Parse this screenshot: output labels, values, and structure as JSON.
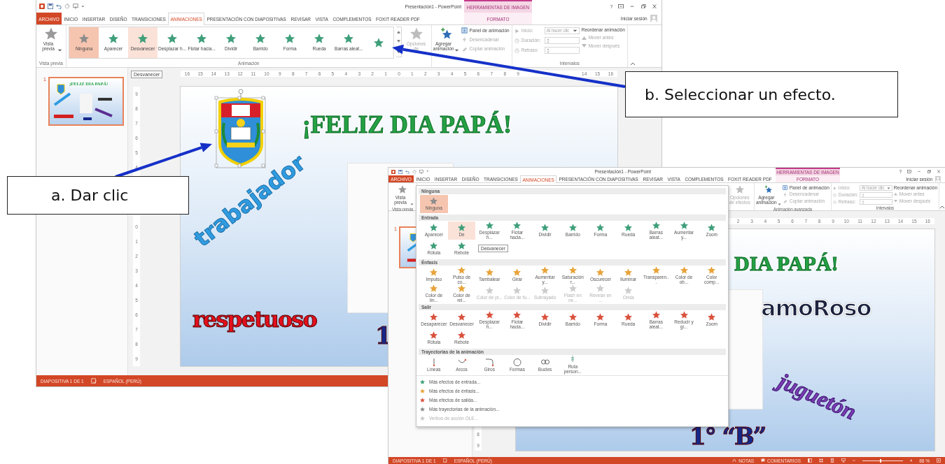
{
  "window_a": {
    "title": "Presentación1 - PowerPoint",
    "contextual_header": "HERRAMIENTAS DE IMAGEN",
    "help": "?",
    "sign_in": "Iniciar sesión",
    "tabs": [
      {
        "label": "ARCHIVO",
        "kind": "file",
        "selected": false
      },
      {
        "label": "INICIO",
        "kind": "tab",
        "selected": false
      },
      {
        "label": "INSERTAR",
        "kind": "tab",
        "selected": false
      },
      {
        "label": "DISEÑO",
        "kind": "tab",
        "selected": false
      },
      {
        "label": "TRANSICIONES",
        "kind": "tab",
        "selected": false
      },
      {
        "label": "ANIMACIONES",
        "kind": "tab",
        "selected": true
      },
      {
        "label": "PRESENTACIÓN CON DIAPOSITIVAS",
        "kind": "tab",
        "selected": false
      },
      {
        "label": "REVISAR",
        "kind": "tab",
        "selected": false
      },
      {
        "label": "VISTA",
        "kind": "tab",
        "selected": false
      },
      {
        "label": "COMPLEMENTOS",
        "kind": "tab",
        "selected": false
      },
      {
        "label": "FOXIT READER PDF",
        "kind": "tab",
        "selected": false
      },
      {
        "label": "FORMATO",
        "kind": "contextual",
        "selected": false
      }
    ],
    "ribbon": {
      "groups": [
        {
          "kind": "preview",
          "label": "Vista previa",
          "button": "Vista previa"
        },
        {
          "kind": "animation",
          "label": "Animación",
          "gallery": [
            {
              "label": "Ninguna",
              "kind": "none",
              "selected": true,
              "hovered": false
            },
            {
              "label": "Aparecer",
              "kind": "entrance",
              "selected": false,
              "hovered": false
            },
            {
              "label": "Desvanecer",
              "kind": "entrance",
              "selected": false,
              "hovered": true
            },
            {
              "label": "Desplazar h...",
              "kind": "entrance",
              "selected": false,
              "hovered": false
            },
            {
              "label": "Flotar hacia...",
              "kind": "entrance",
              "selected": false,
              "hovered": false
            },
            {
              "label": "Dividir",
              "kind": "entrance",
              "selected": false,
              "hovered": false
            },
            {
              "label": "Barrido",
              "kind": "entrance",
              "selected": false,
              "hovered": false
            },
            {
              "label": "Forma",
              "kind": "entrance",
              "selected": false,
              "hovered": false
            },
            {
              "label": "Rueda",
              "kind": "entrance",
              "selected": false,
              "hovered": false
            },
            {
              "label": "Barras aleat...",
              "kind": "entrance",
              "selected": false,
              "hovered": false
            }
          ],
          "effect_options": {
            "label": "Opciones de",
            "disabled": true
          }
        },
        {
          "kind": "advanced",
          "add": "Agregar animación",
          "items": [
            {
              "label": "Panel de animación",
              "disabled": false
            },
            {
              "label": "Desencadenar",
              "disabled": true
            },
            {
              "label": "Copiar animación",
              "disabled": true
            }
          ]
        },
        {
          "kind": "timing",
          "label": "Intervalos",
          "fields": [
            {
              "label": "Inicio:",
              "value": "Al hacer clic",
              "disabled": true
            },
            {
              "label": "Duración:",
              "disabled": true
            },
            {
              "label": "Retraso:",
              "disabled": true
            }
          ],
          "reorder_title": "Reordenar animación",
          "reorder": [
            {
              "label": "Mover antes",
              "disabled": true
            },
            {
              "label": "Mover después",
              "disabled": true
            }
          ]
        }
      ]
    },
    "tooltip": "Desvanecer",
    "slide_number": "1",
    "thumbnail": {
      "title": "¡FELIZ DIA PAPÁ!",
      "selected": true
    },
    "ruler_h_segments": [
      [
        "16",
        "15",
        "14",
        "13",
        "12",
        "11",
        "10",
        "9",
        "8",
        "7",
        "6",
        "5",
        "4",
        "3",
        "2",
        "1",
        "0",
        "1",
        "2",
        "3",
        "4",
        "5",
        "6",
        "7",
        "8",
        "9"
      ],
      [
        "14",
        "15",
        "16"
      ]
    ],
    "ruler_v_segments": [
      [
        "9",
        "8",
        "7",
        "6",
        "5",
        "4"
      ],
      [
        "0",
        "1",
        "2",
        "3",
        "4",
        "5",
        "6",
        "7",
        "8",
        "9"
      ]
    ],
    "slide": {
      "words": [
        {
          "text": "¡FELIZ DIA PAPÁ!",
          "kind": "title",
          "color": "#25a244"
        },
        {
          "text": "trabajador",
          "kind": "diagonal",
          "color": "#2f9be0"
        },
        {
          "text": "respetuoso",
          "kind": "plain",
          "color": "#e3101c"
        },
        {
          "text": "1",
          "kind": "plain",
          "color": "#15288a"
        }
      ]
    },
    "status": {
      "slide": "DIAPOSITIVA 1 DE 1",
      "language": "ESPAÑOL (PERÚ)"
    }
  },
  "window_b": {
    "title": "Presentación1 - PowerPoint",
    "contextual_header": "HERRAMIENTAS DE IMAGEN",
    "help": "?",
    "sign_in": "Iniciar sesión",
    "tabs": [
      {
        "label": "ARCHIVO",
        "kind": "file",
        "selected": false
      },
      {
        "label": "INICIO",
        "kind": "tab",
        "selected": false
      },
      {
        "label": "INSERTAR",
        "kind": "tab",
        "selected": false
      },
      {
        "label": "DISEÑO",
        "kind": "tab",
        "selected": false
      },
      {
        "label": "TRANSICIONES",
        "kind": "tab",
        "selected": false
      },
      {
        "label": "ANIMACIONES",
        "kind": "tab",
        "selected": true
      },
      {
        "label": "PRESENTACIÓN CON DIAPOSITIVAS",
        "kind": "tab",
        "selected": false
      },
      {
        "label": "REVISAR",
        "kind": "tab",
        "selected": false
      },
      {
        "label": "VISTA",
        "kind": "tab",
        "selected": false
      },
      {
        "label": "COMPLEMENTOS",
        "kind": "tab",
        "selected": false
      },
      {
        "label": "FOXIT READER PDF",
        "kind": "tab",
        "selected": false
      },
      {
        "label": "FORMATO",
        "kind": "contextual",
        "selected": false
      }
    ],
    "ribbon": {
      "groups": [
        {
          "kind": "preview",
          "label": "Vista previa",
          "button": "Vista previa"
        },
        {
          "kind": "animation",
          "effect_options": {
            "label": "Opciones de efectos",
            "disabled": true
          }
        },
        {
          "kind": "advanced",
          "label": "Animación avanzada",
          "add": "Agregar animación",
          "items": [
            {
              "label": "Panel de animación",
              "disabled": false
            },
            {
              "label": "Desencadenar",
              "disabled": true
            },
            {
              "label": "Copiar animación",
              "disabled": true
            }
          ]
        },
        {
          "kind": "timing",
          "label": "Intervalos",
          "fields": [
            {
              "label": "Inicio:",
              "value": "Al hacer clic",
              "disabled": true
            },
            {
              "label": "Duración:",
              "disabled": true
            },
            {
              "label": "Retraso:",
              "disabled": true
            }
          ],
          "reorder_title": "Reordenar animación",
          "reorder": [
            {
              "label": "Mover antes",
              "disabled": true
            },
            {
              "label": "Mover después",
              "disabled": true
            }
          ]
        }
      ]
    },
    "menu": {
      "tooltip": "Desvanecer",
      "sections": [
        {
          "title": "Ninguna",
          "items": [
            {
              "label": "Ninguna",
              "kind": "none",
              "selected": true,
              "hovered": false
            }
          ]
        },
        {
          "title": "Entrada",
          "items": [
            {
              "label": "Aparecer",
              "kind": "entrance",
              "selected": false,
              "hovered": false
            },
            {
              "label": "De",
              "kind": "entrance",
              "selected": false,
              "hovered": true
            },
            {
              "label": "Desplazar h...",
              "kind": "entrance",
              "selected": false,
              "hovered": false
            },
            {
              "label": "Flotar hacia...",
              "kind": "entrance",
              "selected": false,
              "hovered": false
            },
            {
              "label": "Dividir",
              "kind": "entrance",
              "selected": false,
              "hovered": false
            },
            {
              "label": "Barrido",
              "kind": "entrance",
              "selected": false,
              "hovered": false
            },
            {
              "label": "Forma",
              "kind": "entrance",
              "selected": false,
              "hovered": false
            },
            {
              "label": "Rueda",
              "kind": "entrance",
              "selected": false,
              "hovered": false
            },
            {
              "label": "Barras aleat...",
              "kind": "entrance",
              "selected": false,
              "hovered": false
            },
            {
              "label": "Aumentar y...",
              "kind": "entrance",
              "selected": false,
              "hovered": false
            },
            {
              "label": "Zoom",
              "kind": "entrance",
              "selected": false,
              "hovered": false
            },
            {
              "label": "Rótula",
              "kind": "entrance",
              "selected": false,
              "hovered": false
            },
            {
              "label": "Rebote",
              "kind": "entrance",
              "selected": false,
              "hovered": false
            }
          ]
        },
        {
          "title": "Énfasis",
          "items": [
            {
              "label": "Impulso",
              "kind": "emphasis",
              "selected": false,
              "hovered": false,
              "disabled": false
            },
            {
              "label": "Pulso de co...",
              "kind": "emphasis",
              "selected": false,
              "hovered": false,
              "disabled": false
            },
            {
              "label": "Tambalear",
              "kind": "emphasis",
              "selected": false,
              "hovered": false,
              "disabled": false
            },
            {
              "label": "Girar",
              "kind": "emphasis",
              "selected": false,
              "hovered": false,
              "disabled": false
            },
            {
              "label": "Aumentar y...",
              "kind": "emphasis",
              "selected": false,
              "hovered": false,
              "disabled": false
            },
            {
              "label": "Saturación r...",
              "kind": "emphasis",
              "selected": false,
              "hovered": false,
              "disabled": false
            },
            {
              "label": "Oscurecer",
              "kind": "emphasis",
              "selected": false,
              "hovered": false,
              "disabled": false
            },
            {
              "label": "Iluminar",
              "kind": "emphasis",
              "selected": false,
              "hovered": false,
              "disabled": false
            },
            {
              "label": "Transparen...",
              "kind": "emphasis",
              "selected": false,
              "hovered": false,
              "disabled": false
            },
            {
              "label": "Color de ob...",
              "kind": "emphasis",
              "selected": false,
              "hovered": false,
              "disabled": false
            },
            {
              "label": "Color comp...",
              "kind": "emphasis",
              "selected": false,
              "hovered": false,
              "disabled": false
            },
            {
              "label": "Color de lín...",
              "kind": "emphasis",
              "selected": false,
              "hovered": false,
              "disabled": false
            },
            {
              "label": "Color de rel...",
              "kind": "emphasis",
              "selected": false,
              "hovered": false,
              "disabled": false
            },
            {
              "label": "Color de pi...",
              "kind": "emphasis",
              "selected": false,
              "hovered": false,
              "disabled": true
            },
            {
              "label": "Color de fu...",
              "kind": "emphasis",
              "selected": false,
              "hovered": false,
              "disabled": true
            },
            {
              "label": "Subrayado",
              "kind": "emphasis",
              "selected": false,
              "hovered": false,
              "disabled": true
            },
            {
              "label": "Flash en ne...",
              "kind": "emphasis",
              "selected": false,
              "hovered": false,
              "disabled": true
            },
            {
              "label": "Revelar en ...",
              "kind": "emphasis",
              "selected": false,
              "hovered": false,
              "disabled": true
            },
            {
              "label": "Onda",
              "kind": "emphasis",
              "selected": false,
              "hovered": false,
              "disabled": true
            }
          ]
        },
        {
          "title": "Salir",
          "items": [
            {
              "label": "Desaparecer",
              "kind": "exit",
              "selected": false,
              "hovered": false
            },
            {
              "label": "Desvanecer",
              "kind": "exit",
              "selected": false,
              "hovered": false
            },
            {
              "label": "Desplazar h...",
              "kind": "exit",
              "selected": false,
              "hovered": false
            },
            {
              "label": "Flotar hacia...",
              "kind": "exit",
              "selected": false,
              "hovered": false
            },
            {
              "label": "Dividir",
              "kind": "exit",
              "selected": false,
              "hovered": false
            },
            {
              "label": "Barrido",
              "kind": "exit",
              "selected": false,
              "hovered": false
            },
            {
              "label": "Forma",
              "kind": "exit",
              "selected": false,
              "hovered": false
            },
            {
              "label": "Rueda",
              "kind": "exit",
              "selected": false,
              "hovered": false
            },
            {
              "label": "Barras aleat...",
              "kind": "exit",
              "selected": false,
              "hovered": false
            },
            {
              "label": "Reducir y gi...",
              "kind": "exit",
              "selected": false,
              "hovered": false
            },
            {
              "label": "Zoom",
              "kind": "exit",
              "selected": false,
              "hovered": false
            },
            {
              "label": "Rótula",
              "kind": "exit",
              "selected": false,
              "hovered": false
            },
            {
              "label": "Rebote",
              "kind": "exit",
              "selected": false,
              "hovered": false
            }
          ]
        },
        {
          "title": "Trayectorias de la animación",
          "items": [
            {
              "label": "Líneas",
              "kind": "line",
              "selected": false,
              "hovered": false
            },
            {
              "label": "Arcos",
              "kind": "arc",
              "selected": false,
              "hovered": false
            },
            {
              "label": "Giros",
              "kind": "turn",
              "selected": false,
              "hovered": false
            },
            {
              "label": "Formas",
              "kind": "circle",
              "selected": false,
              "hovered": false
            },
            {
              "label": "Bucles",
              "kind": "loops",
              "selected": false,
              "hovered": false
            },
            {
              "label": "Ruta person...",
              "kind": "custom",
              "selected": false,
              "hovered": false
            }
          ]
        }
      ],
      "links": [
        {
          "label": "Más efectos de entrada...",
          "color": "#3f9f7a",
          "disabled": false
        },
        {
          "label": "Más efectos de énfasis...",
          "color": "#e8a33a",
          "disabled": false
        },
        {
          "label": "Más efectos de salida...",
          "color": "#d9523d",
          "disabled": false
        },
        {
          "label": "Más trayectorias de la animación...",
          "color": "#8a8a8a",
          "disabled": false
        },
        {
          "label": "Verbos de acción OLE...",
          "color": "#c8c8c8",
          "disabled": true
        }
      ]
    },
    "slide_number": "1",
    "thumbnail": {
      "selected": true
    },
    "ruler_h_segments": [
      [
        "2",
        "3",
        "4",
        "5",
        "6",
        "7",
        "8",
        "9",
        "10",
        "11",
        "12",
        "13",
        "14",
        "15",
        "16"
      ]
    ],
    "ruler_v_segments": [
      [
        "8",
        "9"
      ]
    ],
    "slide": {
      "words": [
        {
          "text": "DIA PAPÁ!",
          "kind": "title",
          "color": "#25a244"
        },
        {
          "text": "amoRoso",
          "kind": "outlined",
          "color": "#1d2440"
        },
        {
          "text": "juguetón",
          "kind": "tilted",
          "color": "#7a3db3"
        },
        {
          "text": "1° “B”",
          "kind": "plain",
          "color": "#15288a"
        }
      ]
    },
    "status": {
      "slide": "DIAPOSITIVA 1 DE 1",
      "language": "ESPAÑOL (PERÚ)",
      "notes": "NOTAS",
      "comments": "COMENTARIOS",
      "zoom": "88 %",
      "zoom_slider": {
        "level": 0.46
      }
    }
  },
  "callouts": [
    {
      "text": "a. Dar clic"
    },
    {
      "text": "b. Seleccionar un efecto."
    }
  ]
}
